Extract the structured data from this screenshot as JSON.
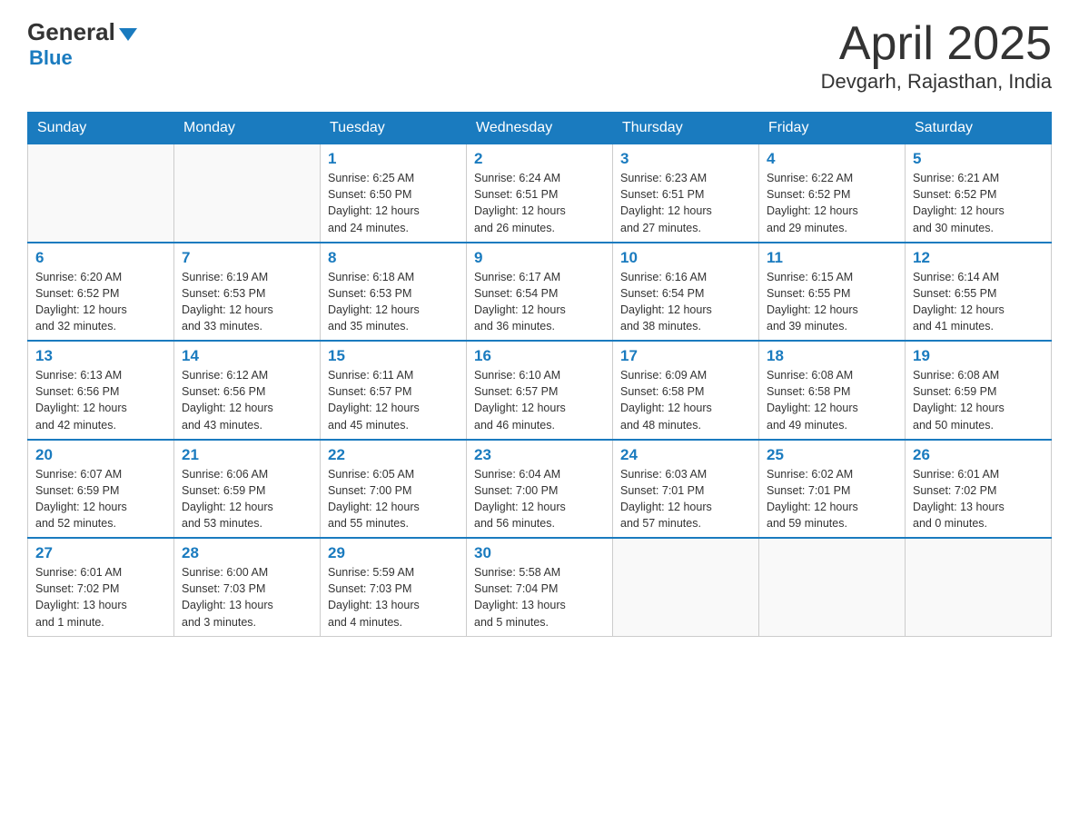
{
  "header": {
    "logo_general": "General",
    "logo_blue": "Blue",
    "month": "April 2025",
    "location": "Devgarh, Rajasthan, India"
  },
  "weekdays": [
    "Sunday",
    "Monday",
    "Tuesday",
    "Wednesday",
    "Thursday",
    "Friday",
    "Saturday"
  ],
  "weeks": [
    [
      {
        "day": "",
        "info": ""
      },
      {
        "day": "",
        "info": ""
      },
      {
        "day": "1",
        "info": "Sunrise: 6:25 AM\nSunset: 6:50 PM\nDaylight: 12 hours\nand 24 minutes."
      },
      {
        "day": "2",
        "info": "Sunrise: 6:24 AM\nSunset: 6:51 PM\nDaylight: 12 hours\nand 26 minutes."
      },
      {
        "day": "3",
        "info": "Sunrise: 6:23 AM\nSunset: 6:51 PM\nDaylight: 12 hours\nand 27 minutes."
      },
      {
        "day": "4",
        "info": "Sunrise: 6:22 AM\nSunset: 6:52 PM\nDaylight: 12 hours\nand 29 minutes."
      },
      {
        "day": "5",
        "info": "Sunrise: 6:21 AM\nSunset: 6:52 PM\nDaylight: 12 hours\nand 30 minutes."
      }
    ],
    [
      {
        "day": "6",
        "info": "Sunrise: 6:20 AM\nSunset: 6:52 PM\nDaylight: 12 hours\nand 32 minutes."
      },
      {
        "day": "7",
        "info": "Sunrise: 6:19 AM\nSunset: 6:53 PM\nDaylight: 12 hours\nand 33 minutes."
      },
      {
        "day": "8",
        "info": "Sunrise: 6:18 AM\nSunset: 6:53 PM\nDaylight: 12 hours\nand 35 minutes."
      },
      {
        "day": "9",
        "info": "Sunrise: 6:17 AM\nSunset: 6:54 PM\nDaylight: 12 hours\nand 36 minutes."
      },
      {
        "day": "10",
        "info": "Sunrise: 6:16 AM\nSunset: 6:54 PM\nDaylight: 12 hours\nand 38 minutes."
      },
      {
        "day": "11",
        "info": "Sunrise: 6:15 AM\nSunset: 6:55 PM\nDaylight: 12 hours\nand 39 minutes."
      },
      {
        "day": "12",
        "info": "Sunrise: 6:14 AM\nSunset: 6:55 PM\nDaylight: 12 hours\nand 41 minutes."
      }
    ],
    [
      {
        "day": "13",
        "info": "Sunrise: 6:13 AM\nSunset: 6:56 PM\nDaylight: 12 hours\nand 42 minutes."
      },
      {
        "day": "14",
        "info": "Sunrise: 6:12 AM\nSunset: 6:56 PM\nDaylight: 12 hours\nand 43 minutes."
      },
      {
        "day": "15",
        "info": "Sunrise: 6:11 AM\nSunset: 6:57 PM\nDaylight: 12 hours\nand 45 minutes."
      },
      {
        "day": "16",
        "info": "Sunrise: 6:10 AM\nSunset: 6:57 PM\nDaylight: 12 hours\nand 46 minutes."
      },
      {
        "day": "17",
        "info": "Sunrise: 6:09 AM\nSunset: 6:58 PM\nDaylight: 12 hours\nand 48 minutes."
      },
      {
        "day": "18",
        "info": "Sunrise: 6:08 AM\nSunset: 6:58 PM\nDaylight: 12 hours\nand 49 minutes."
      },
      {
        "day": "19",
        "info": "Sunrise: 6:08 AM\nSunset: 6:59 PM\nDaylight: 12 hours\nand 50 minutes."
      }
    ],
    [
      {
        "day": "20",
        "info": "Sunrise: 6:07 AM\nSunset: 6:59 PM\nDaylight: 12 hours\nand 52 minutes."
      },
      {
        "day": "21",
        "info": "Sunrise: 6:06 AM\nSunset: 6:59 PM\nDaylight: 12 hours\nand 53 minutes."
      },
      {
        "day": "22",
        "info": "Sunrise: 6:05 AM\nSunset: 7:00 PM\nDaylight: 12 hours\nand 55 minutes."
      },
      {
        "day": "23",
        "info": "Sunrise: 6:04 AM\nSunset: 7:00 PM\nDaylight: 12 hours\nand 56 minutes."
      },
      {
        "day": "24",
        "info": "Sunrise: 6:03 AM\nSunset: 7:01 PM\nDaylight: 12 hours\nand 57 minutes."
      },
      {
        "day": "25",
        "info": "Sunrise: 6:02 AM\nSunset: 7:01 PM\nDaylight: 12 hours\nand 59 minutes."
      },
      {
        "day": "26",
        "info": "Sunrise: 6:01 AM\nSunset: 7:02 PM\nDaylight: 13 hours\nand 0 minutes."
      }
    ],
    [
      {
        "day": "27",
        "info": "Sunrise: 6:01 AM\nSunset: 7:02 PM\nDaylight: 13 hours\nand 1 minute."
      },
      {
        "day": "28",
        "info": "Sunrise: 6:00 AM\nSunset: 7:03 PM\nDaylight: 13 hours\nand 3 minutes."
      },
      {
        "day": "29",
        "info": "Sunrise: 5:59 AM\nSunset: 7:03 PM\nDaylight: 13 hours\nand 4 minutes."
      },
      {
        "day": "30",
        "info": "Sunrise: 5:58 AM\nSunset: 7:04 PM\nDaylight: 13 hours\nand 5 minutes."
      },
      {
        "day": "",
        "info": ""
      },
      {
        "day": "",
        "info": ""
      },
      {
        "day": "",
        "info": ""
      }
    ]
  ]
}
